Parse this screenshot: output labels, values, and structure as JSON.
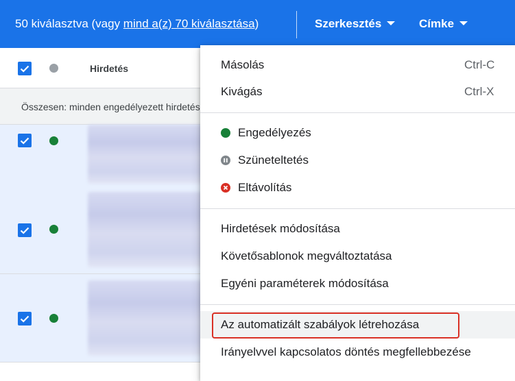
{
  "toolbar": {
    "selected_text": "50 kiválasztva (vagy ",
    "select_all_link": "mind a(z) 70 kiválasztása",
    "selected_text_end": ")",
    "edit_label": "Szerkesztés",
    "label_label": "Címke",
    "background_color": "#1a73e8"
  },
  "table": {
    "header_column": "Hirdetés",
    "summary": "Összesen: minden engedélyezett hirdetés",
    "row_status_color": "#188038",
    "header_status_color": "#9aa0a6"
  },
  "menu": {
    "copy": {
      "label": "Másolás",
      "shortcut": "Ctrl-C"
    },
    "cut": {
      "label": "Kivágás",
      "shortcut": "Ctrl-X"
    },
    "enable": {
      "label": "Engedélyezés",
      "icon": "green-dot-icon",
      "color": "#188038"
    },
    "pause": {
      "label": "Szüneteltetés",
      "icon": "pause-icon",
      "color": "#80868b"
    },
    "remove": {
      "label": "Eltávolítás",
      "icon": "remove-x-icon",
      "color": "#d93025"
    },
    "edit_ads": "Hirdetések módosítása",
    "change_tracking": "Követősablonok megváltoztatása",
    "edit_custom_params": "Egyéni paraméterek módosítása",
    "create_rules": "Az automatizált szabályok létrehozása",
    "appeal_policy": "Irányelvvel kapcsolatos döntés megfellebbezése"
  }
}
